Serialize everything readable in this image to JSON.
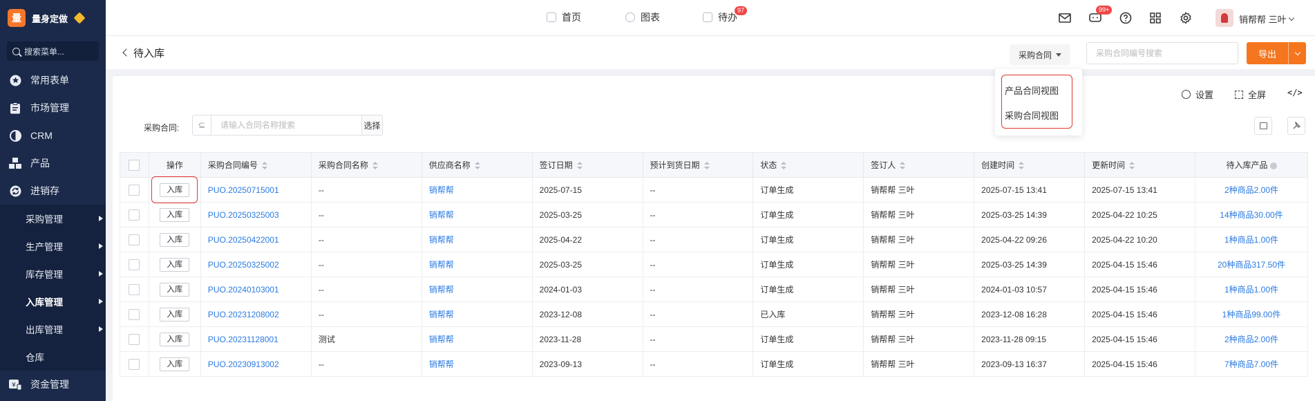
{
  "brand": {
    "logo_char": "量",
    "name": "量身定做"
  },
  "sidebar": {
    "search_placeholder": "搜索菜单...",
    "items": [
      {
        "label": "常用表单",
        "icon": "star-icon"
      },
      {
        "label": "市场管理",
        "icon": "clipboard-icon"
      },
      {
        "label": "CRM",
        "icon": "pie-icon"
      },
      {
        "label": "产品",
        "icon": "boxes-icon"
      },
      {
        "label": "进销存",
        "icon": "cycle-icon"
      }
    ],
    "sub_items": [
      {
        "label": "采购管理",
        "has_arrow": true
      },
      {
        "label": "生产管理",
        "has_arrow": true
      },
      {
        "label": "库存管理",
        "has_arrow": true
      },
      {
        "label": "入库管理",
        "has_arrow": true
      },
      {
        "label": "出库管理",
        "has_arrow": true
      },
      {
        "label": "仓库",
        "has_arrow": false
      }
    ],
    "last_item": {
      "label": "资金管理",
      "icon": "money-icon"
    }
  },
  "topbar": {
    "tabs": [
      {
        "label": "首页"
      },
      {
        "label": "图表"
      },
      {
        "label": "待办",
        "badge": "97"
      }
    ],
    "message_badge": "99+",
    "user_name": "销帮帮 三叶"
  },
  "subhead": {
    "title": "待入库",
    "contract_select": "采购合同",
    "search_placeholder": "采购合同编号搜索",
    "export_label": "导出"
  },
  "dropdown": {
    "items": [
      "产品合同视图",
      "采购合同视图"
    ]
  },
  "toolbar": {
    "settings_label": "设置",
    "fullscreen_label": "全屏",
    "code_label": "</>"
  },
  "filter": {
    "label": "采购合同:",
    "placeholder": "请输入合同名称搜索",
    "select_label": "选择",
    "prefix_glyph": "⊆"
  },
  "table": {
    "headers": {
      "op": "操作",
      "code": "采购合同编号",
      "name": "采购合同名称",
      "supplier": "供应商名称",
      "sign_date": "签订日期",
      "arrival_date": "预计到货日期",
      "status": "状态",
      "signer": "签订人",
      "created": "创建时间",
      "updated": "更新时间",
      "products": "待入库产品"
    },
    "action_label": "入库",
    "rows": [
      {
        "code": "PUO.20250715001",
        "name": "--",
        "supplier": "销帮帮",
        "sign_date": "2025-07-15",
        "arrival": "--",
        "status": "订单生成",
        "signer": "销帮帮 三叶",
        "created": "2025-07-15 13:41",
        "updated": "2025-07-15 13:41",
        "products": "2种商品2.00件"
      },
      {
        "code": "PUO.20250325003",
        "name": "--",
        "supplier": "销帮帮",
        "sign_date": "2025-03-25",
        "arrival": "--",
        "status": "订单生成",
        "signer": "销帮帮 三叶",
        "created": "2025-03-25 14:39",
        "updated": "2025-04-22 10:25",
        "products": "14种商品30.00件"
      },
      {
        "code": "PUO.20250422001",
        "name": "--",
        "supplier": "销帮帮",
        "sign_date": "2025-04-22",
        "arrival": "--",
        "status": "订单生成",
        "signer": "销帮帮 三叶",
        "created": "2025-04-22 09:26",
        "updated": "2025-04-22 10:20",
        "products": "1种商品1.00件"
      },
      {
        "code": "PUO.20250325002",
        "name": "--",
        "supplier": "销帮帮",
        "sign_date": "2025-03-25",
        "arrival": "--",
        "status": "订单生成",
        "signer": "销帮帮 三叶",
        "created": "2025-03-25 14:39",
        "updated": "2025-04-15 15:46",
        "products": "20种商品317.50件"
      },
      {
        "code": "PUO.20240103001",
        "name": "--",
        "supplier": "销帮帮",
        "sign_date": "2024-01-03",
        "arrival": "--",
        "status": "订单生成",
        "signer": "销帮帮 三叶",
        "created": "2024-01-03 10:57",
        "updated": "2025-04-15 15:46",
        "products": "1种商品1.00件"
      },
      {
        "code": "PUO.20231208002",
        "name": "--",
        "supplier": "销帮帮",
        "sign_date": "2023-12-08",
        "arrival": "--",
        "status": "已入库",
        "signer": "销帮帮 三叶",
        "created": "2023-12-08 16:28",
        "updated": "2025-04-15 15:46",
        "products": "1种商品99.00件"
      },
      {
        "code": "PUO.20231128001",
        "name": "测试",
        "supplier": "销帮帮",
        "sign_date": "2023-11-28",
        "arrival": "--",
        "status": "订单生成",
        "signer": "销帮帮 三叶",
        "created": "2023-11-28 09:15",
        "updated": "2025-04-15 15:46",
        "products": "2种商品2.00件"
      },
      {
        "code": "PUO.20230913002",
        "name": "--",
        "supplier": "销帮帮",
        "sign_date": "2023-09-13",
        "arrival": "--",
        "status": "订单生成",
        "signer": "销帮帮 三叶",
        "created": "2023-09-13 16:37",
        "updated": "2025-04-15 15:46",
        "products": "7种商品7.00件"
      }
    ]
  },
  "colors": {
    "sidebar_bg": "#1b2a4a",
    "accent_orange": "#f5761f",
    "link_blue": "#2a7ae2",
    "highlight_red": "#e0392f",
    "badge_red": "#f04848"
  }
}
